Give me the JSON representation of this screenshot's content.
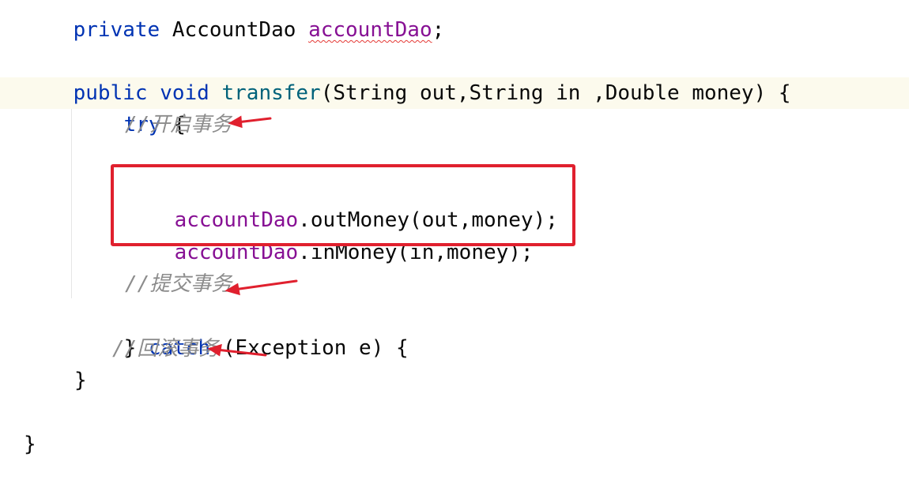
{
  "code": {
    "l1": {
      "kw": "private",
      "type": "AccountDao",
      "field": "accountDao",
      "end": ";"
    },
    "l2": {
      "public": "public",
      "void": "void",
      "name": "transfer",
      "params": "(String out,String in ,Double money) {"
    },
    "l3": {
      "try": "try",
      "brace": "{"
    },
    "l4": {
      "comment": "//开启事务"
    },
    "l5": {
      "field": "accountDao",
      "rest": ".outMoney(out,money);"
    },
    "l6": {
      "field": "accountDao",
      "rest": ".inMoney(in,money);"
    },
    "l7": {
      "comment": "//提交事务"
    },
    "l8": {
      "close": "} ",
      "catch": "catch",
      "rest": " (Exception e) {"
    },
    "l9": {
      "comment": "//回滚事务"
    },
    "l10": {
      "close": "}"
    },
    "l11": {
      "close": "}"
    }
  },
  "colors": {
    "keyword": "#0033b3",
    "method": "#00627a",
    "field": "#871094",
    "comment": "#8c8c8c",
    "annotation": "#e0202e"
  }
}
